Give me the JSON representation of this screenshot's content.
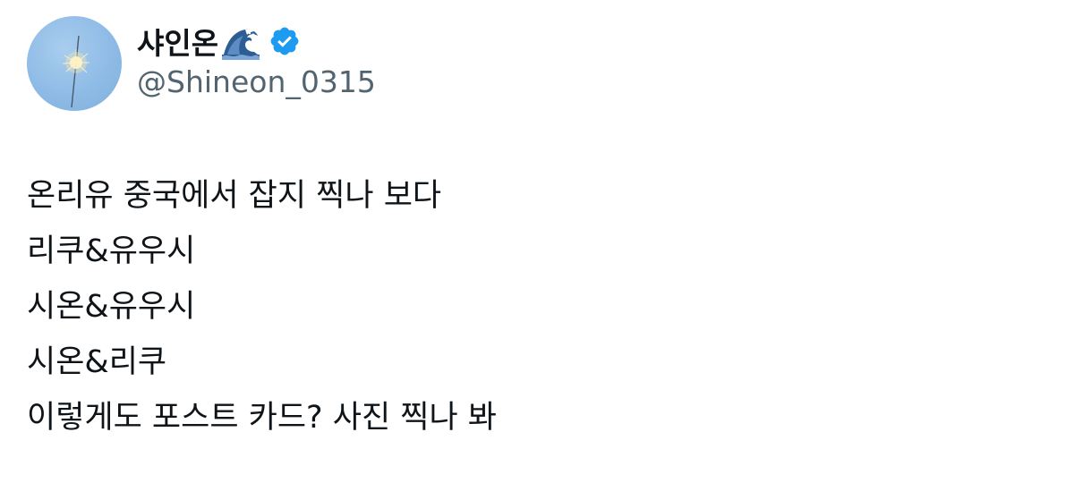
{
  "author": {
    "display_name": "샤인온",
    "name_emoji": "wave-icon",
    "verified": true,
    "verified_icon": "verified-badge-icon",
    "verified_color": "#1d9bf0",
    "handle": "@Shineon_0315"
  },
  "tweet": {
    "lines": [
      "온리유 중국에서 잡지 찍나 보다",
      "리쿠&유우시",
      "시온&유우시",
      "시온&리쿠",
      "이렇게도 포스트 카드? 사진 찍나 봐"
    ]
  }
}
